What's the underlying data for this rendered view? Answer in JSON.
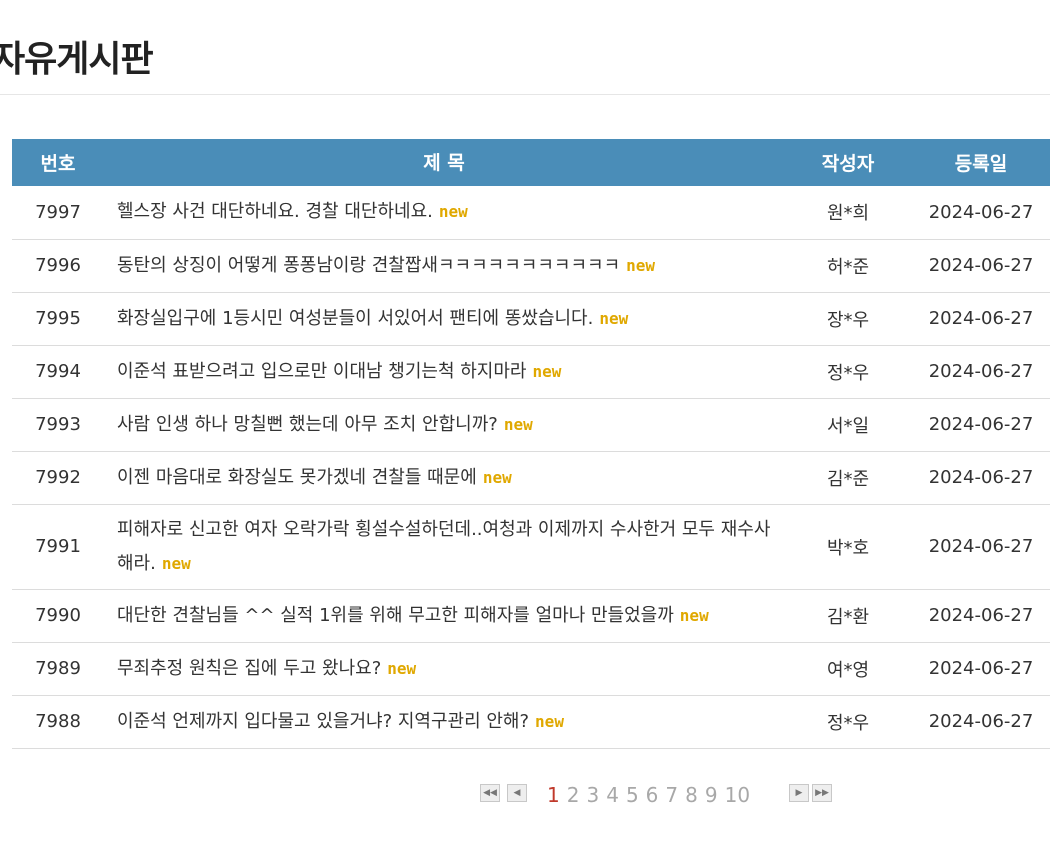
{
  "board": {
    "title": "자유게시판",
    "columns": {
      "no": "번호",
      "subject": "제 목",
      "writer": "작성자",
      "date": "등록일"
    },
    "new_label": "new",
    "posts": [
      {
        "no": "7997",
        "subject": "헬스장 사건 대단하네요. 경찰 대단하네요.",
        "writer": "원*희",
        "date": "2024-06-27"
      },
      {
        "no": "7996",
        "subject": "동탄의 상징이 어떻게 퐁퐁남이랑 견찰짭새ㅋㅋㅋㅋㅋㅋㅋㅋㅋㅋㅋ",
        "writer": "허*준",
        "date": "2024-06-27"
      },
      {
        "no": "7995",
        "subject": "화장실입구에 1등시민 여성분들이 서있어서 팬티에 똥쌌습니다.",
        "writer": "장*우",
        "date": "2024-06-27"
      },
      {
        "no": "7994",
        "subject": "이준석 표받으려고 입으로만 이대남 챙기는척 하지마라",
        "writer": "정*우",
        "date": "2024-06-27"
      },
      {
        "no": "7993",
        "subject": "사람 인생 하나 망칠뻔 했는데 아무 조치 안합니까?",
        "writer": "서*일",
        "date": "2024-06-27"
      },
      {
        "no": "7992",
        "subject": "이젠 마음대로 화장실도 못가겠네 견찰들 때문에",
        "writer": "김*준",
        "date": "2024-06-27"
      },
      {
        "no": "7991",
        "subject": "피해자로 신고한 여자 오락가락 횡설수설하던데..여청과 이제까지 수사한거 모두 재수사해라.",
        "writer": "박*호",
        "date": "2024-06-27"
      },
      {
        "no": "7990",
        "subject": "대단한 견찰님들 ^^ 실적 1위를 위해 무고한 피해자를 얼마나 만들었을까",
        "writer": "김*환",
        "date": "2024-06-27"
      },
      {
        "no": "7989",
        "subject": "무죄추정 원칙은 집에 두고 왔나요?",
        "writer": "여*영",
        "date": "2024-06-27"
      },
      {
        "no": "7988",
        "subject": "이준석 언제까지 입다물고 있을거냐? 지역구관리 안해?",
        "writer": "정*우",
        "date": "2024-06-27"
      }
    ]
  },
  "pagination": {
    "first_icon": "double-left-arrow-icon",
    "prev_icon": "left-arrow-icon",
    "next_icon": "right-arrow-icon",
    "last_icon": "double-right-arrow-icon",
    "pages": [
      "1",
      "2",
      "3",
      "4",
      "5",
      "6",
      "7",
      "8",
      "9",
      "10"
    ],
    "current": "1"
  },
  "colors": {
    "header_bg": "#4a8db8",
    "new_badge": "#e0a800",
    "current_page": "#c0392b"
  }
}
